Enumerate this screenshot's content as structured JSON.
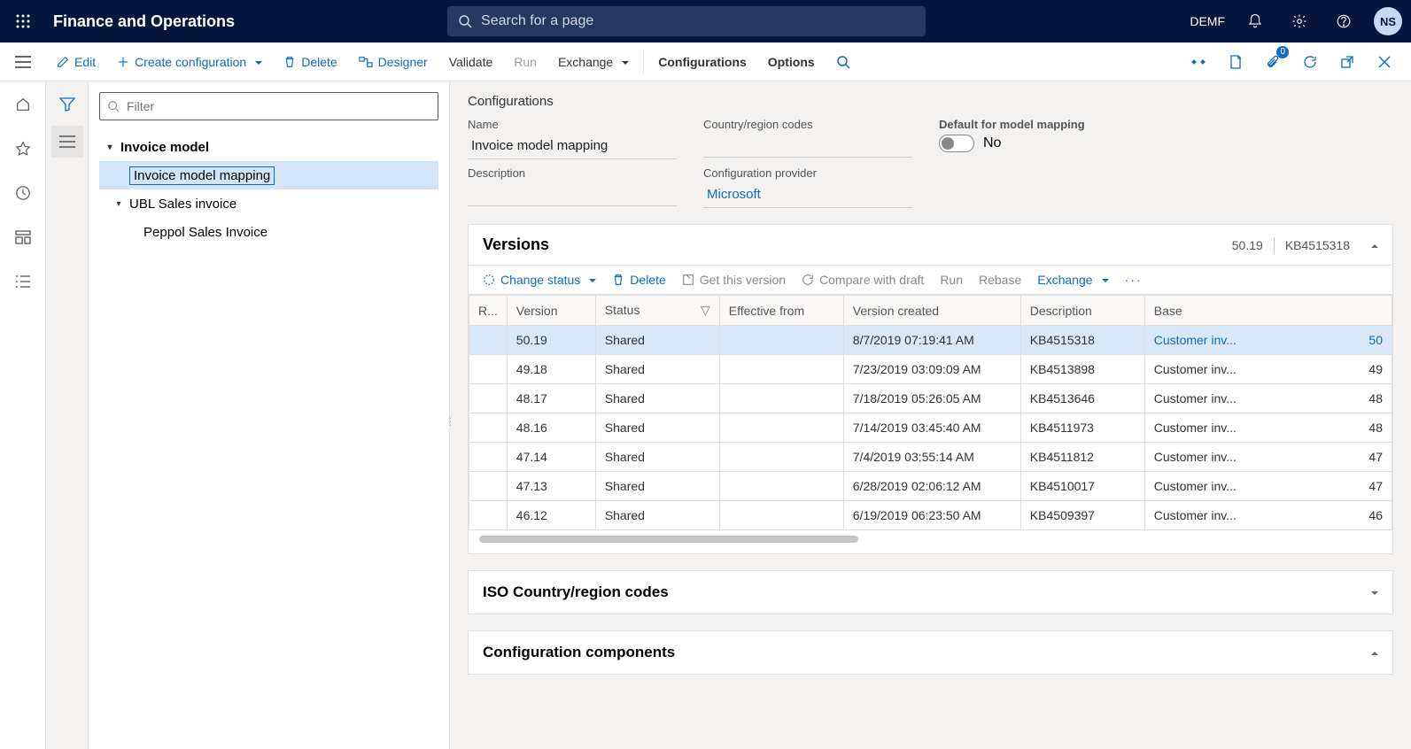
{
  "topbar": {
    "brand": "Finance and Operations",
    "search_placeholder": "Search for a page",
    "company": "DEMF",
    "avatar": "NS"
  },
  "cmdbar": {
    "edit": "Edit",
    "create": "Create configuration",
    "delete": "Delete",
    "designer": "Designer",
    "validate": "Validate",
    "run": "Run",
    "exchange": "Exchange",
    "configurations": "Configurations",
    "options": "Options",
    "attach_badge": "0"
  },
  "tree": {
    "filter_placeholder": "Filter",
    "root": "Invoice model",
    "child1": "Invoice model mapping",
    "child2": "UBL Sales invoice",
    "child3": "Peppol Sales Invoice"
  },
  "config": {
    "section": "Configurations",
    "name_label": "Name",
    "name_value": "Invoice model mapping",
    "country_label": "Country/region codes",
    "country_value": "",
    "default_label": "Default for model mapping",
    "default_value": "No",
    "desc_label": "Description",
    "desc_value": "",
    "provider_label": "Configuration provider",
    "provider_value": "Microsoft"
  },
  "versions": {
    "title": "Versions",
    "header_version": "50.19",
    "header_kb": "KB4515318",
    "toolbar": {
      "change_status": "Change status",
      "delete": "Delete",
      "get": "Get this version",
      "compare": "Compare with draft",
      "run": "Run",
      "rebase": "Rebase",
      "exchange": "Exchange"
    },
    "cols": {
      "r": "R...",
      "version": "Version",
      "status": "Status",
      "effective": "Effective from",
      "created": "Version created",
      "description": "Description",
      "base": "Base"
    },
    "rows": [
      {
        "version": "50.19",
        "status": "Shared",
        "effective": "",
        "created": "8/7/2019 07:19:41 AM",
        "description": "KB4515318",
        "base": "Customer inv...",
        "basenum": "50"
      },
      {
        "version": "49.18",
        "status": "Shared",
        "effective": "",
        "created": "7/23/2019 03:09:09 AM",
        "description": "KB4513898",
        "base": "Customer inv...",
        "basenum": "49"
      },
      {
        "version": "48.17",
        "status": "Shared",
        "effective": "",
        "created": "7/18/2019 05:26:05 AM",
        "description": "KB4513646",
        "base": "Customer inv...",
        "basenum": "48"
      },
      {
        "version": "48.16",
        "status": "Shared",
        "effective": "",
        "created": "7/14/2019 03:45:40 AM",
        "description": "KB4511973",
        "base": "Customer inv...",
        "basenum": "48"
      },
      {
        "version": "47.14",
        "status": "Shared",
        "effective": "",
        "created": "7/4/2019 03:55:14 AM",
        "description": "KB4511812",
        "base": "Customer inv...",
        "basenum": "47"
      },
      {
        "version": "47.13",
        "status": "Shared",
        "effective": "",
        "created": "6/28/2019 02:06:12 AM",
        "description": "KB4510017",
        "base": "Customer inv...",
        "basenum": "47"
      },
      {
        "version": "46.12",
        "status": "Shared",
        "effective": "",
        "created": "6/19/2019 06:23:50 AM",
        "description": "KB4509397",
        "base": "Customer inv...",
        "basenum": "46"
      }
    ]
  },
  "iso_section": "ISO Country/region codes",
  "components_section": "Configuration components"
}
